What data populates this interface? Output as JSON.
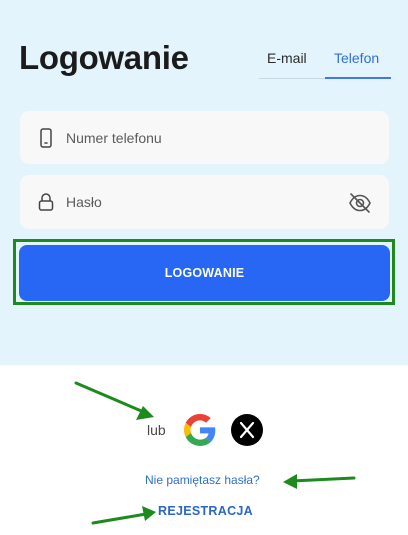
{
  "header": {
    "title": "Logowanie"
  },
  "tabs": [
    {
      "label": "E-mail",
      "active": false
    },
    {
      "label": "Telefon",
      "active": true
    }
  ],
  "form": {
    "phone": {
      "placeholder": "Numer telefonu",
      "icon": "phone-icon"
    },
    "password": {
      "placeholder": "Hasło",
      "icon": "lock-icon",
      "toggle_icon": "eye-off-icon"
    },
    "submit_label": "LOGOWANIE"
  },
  "social": {
    "separator": "lub",
    "providers": [
      "google",
      "x"
    ]
  },
  "links": {
    "forgot": "Nie pamiętasz hasła?",
    "register": "REJESTRACJA"
  },
  "colors": {
    "accent": "#2767f3",
    "background_top": "#e3f4fc",
    "highlight": "#1d8a1d"
  }
}
